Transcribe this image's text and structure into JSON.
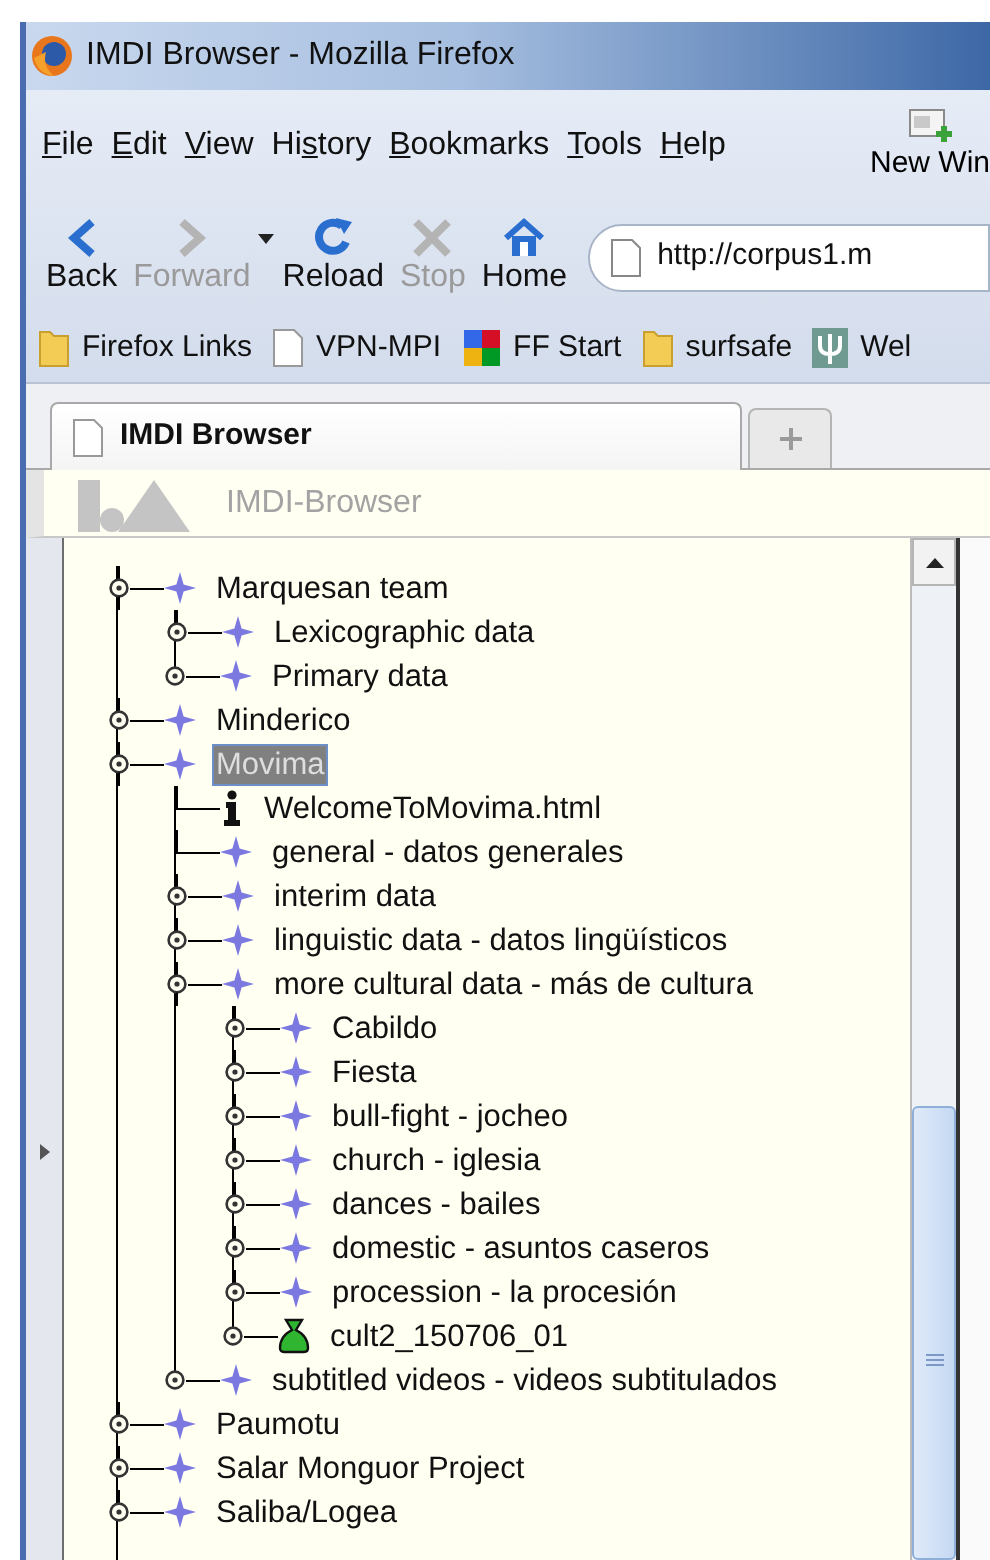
{
  "window": {
    "title": "IMDI Browser - Mozilla Firefox"
  },
  "menu": [
    {
      "key": "F",
      "after": "ile"
    },
    {
      "key": "E",
      "after": "dit"
    },
    {
      "key": "V",
      "after": "iew"
    },
    {
      "before": "Hi",
      "key": "s",
      "after": "tory"
    },
    {
      "key": "B",
      "after": "ookmarks"
    },
    {
      "key": "T",
      "after": "ools"
    },
    {
      "key": "H",
      "after": "elp"
    }
  ],
  "menu_button": {
    "label": "New Win"
  },
  "navigation": [
    {
      "label": "Back",
      "kind": "back",
      "disabled": false
    },
    {
      "label": "Forward",
      "kind": "forward",
      "disabled": true,
      "dropdown": true
    },
    {
      "label": "Reload",
      "kind": "reload",
      "disabled": false
    },
    {
      "label": "Stop",
      "kind": "stop",
      "disabled": true
    },
    {
      "label": "Home",
      "kind": "home",
      "disabled": false
    }
  ],
  "address_bar": {
    "value": "http://corpus1.m"
  },
  "bookmarks": [
    {
      "label": "Firefox Links",
      "kind": "folder"
    },
    {
      "label": "VPN-MPI",
      "kind": "page"
    },
    {
      "label": "FF Start",
      "kind": "google"
    },
    {
      "label": "surfsafe",
      "kind": "folder"
    },
    {
      "label": "Wel",
      "kind": "psi"
    }
  ],
  "tabs": [
    {
      "label": "IMDI Browser",
      "selected": true
    }
  ],
  "app_header": {
    "title": "IMDI-Browser"
  },
  "tree": [
    {
      "label": "Marquesan team",
      "kind": "corpus",
      "selected": false,
      "expanded": true,
      "children": [
        {
          "label": "Lexicographic data",
          "kind": "corpus",
          "selected": false,
          "expanded": false
        },
        {
          "label": "Primary data",
          "kind": "corpus",
          "selected": false,
          "expanded": false
        }
      ]
    },
    {
      "label": "Minderico",
      "kind": "corpus",
      "selected": false,
      "expanded": false
    },
    {
      "label": "Movima",
      "kind": "corpus",
      "selected": true,
      "expanded": true,
      "children": [
        {
          "label": "WelcomeToMovima.html",
          "kind": "info",
          "selected": false
        },
        {
          "label": "general - datos generales",
          "kind": "corpus",
          "selected": false
        },
        {
          "label": "interim data",
          "kind": "corpus",
          "selected": false,
          "expanded": false
        },
        {
          "label": "linguistic data - datos lingüísticos",
          "kind": "corpus",
          "selected": false,
          "expanded": false
        },
        {
          "label": "more cultural data - más de cultura",
          "kind": "corpus",
          "selected": false,
          "expanded": true,
          "children": [
            {
              "label": "Cabildo",
              "kind": "corpus",
              "selected": false,
              "expanded": false
            },
            {
              "label": "Fiesta",
              "kind": "corpus",
              "selected": false,
              "expanded": false
            },
            {
              "label": "bull-fight - jocheo",
              "kind": "corpus",
              "selected": false,
              "expanded": false
            },
            {
              "label": "church - iglesia",
              "kind": "corpus",
              "selected": false,
              "expanded": false
            },
            {
              "label": "dances - bailes",
              "kind": "corpus",
              "selected": false,
              "expanded": false
            },
            {
              "label": "domestic - asuntos caseros",
              "kind": "corpus",
              "selected": false,
              "expanded": false
            },
            {
              "label": "procession - la procesión",
              "kind": "corpus",
              "selected": false,
              "expanded": false
            },
            {
              "label": "cult2_150706_01",
              "kind": "session",
              "selected": false,
              "expanded": false
            }
          ]
        },
        {
          "label": "subtitled videos - videos subtitulados",
          "kind": "corpus",
          "selected": false,
          "expanded": false
        }
      ]
    },
    {
      "label": "Paumotu",
      "kind": "corpus",
      "selected": false,
      "expanded": false
    },
    {
      "label": "Salar Monguor Project",
      "kind": "corpus",
      "selected": false,
      "expanded": false
    },
    {
      "label": "Saliba/Logea",
      "kind": "corpus",
      "selected": false,
      "expanded": false
    }
  ]
}
